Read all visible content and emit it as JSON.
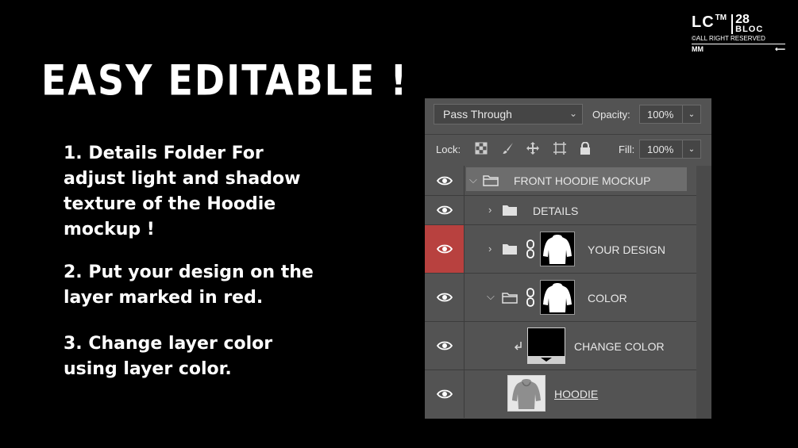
{
  "title": "EASY EDITABLE !",
  "steps": [
    "1. Details Folder For adjust light and shadow texture of the Hoodie mockup !",
    "2. Put your design on the layer marked in red.",
    "3. Change layer color using layer color."
  ],
  "brand": {
    "lc": "LC",
    "tm": "TM",
    "num": "28",
    "bloc": "BLOC",
    "rights": "©ALL RIGHT RESERVED",
    "mm": "MM",
    "arrow": "⟵"
  },
  "panel": {
    "blend_mode": "Pass Through",
    "opacity_label": "Opacity:",
    "opacity_value": "100%",
    "lock_label": "Lock:",
    "fill_label": "Fill:",
    "fill_value": "100%",
    "layers": [
      {
        "name": "FRONT HOODIE MOCKUP",
        "type": "group-open",
        "highlight": false
      },
      {
        "name": "DETAILS",
        "type": "group-closed",
        "highlight": false
      },
      {
        "name": "YOUR DESIGN",
        "type": "group-masked",
        "highlight": true
      },
      {
        "name": "COLOR",
        "type": "group-masked-open",
        "highlight": false
      },
      {
        "name": "CHANGE COLOR",
        "type": "fill-layer",
        "highlight": false
      },
      {
        "name": "HOODIE",
        "type": "smart-object",
        "highlight": false
      }
    ]
  },
  "colors": {
    "highlight_red": "#b8413f",
    "panel_bg": "#535353"
  }
}
